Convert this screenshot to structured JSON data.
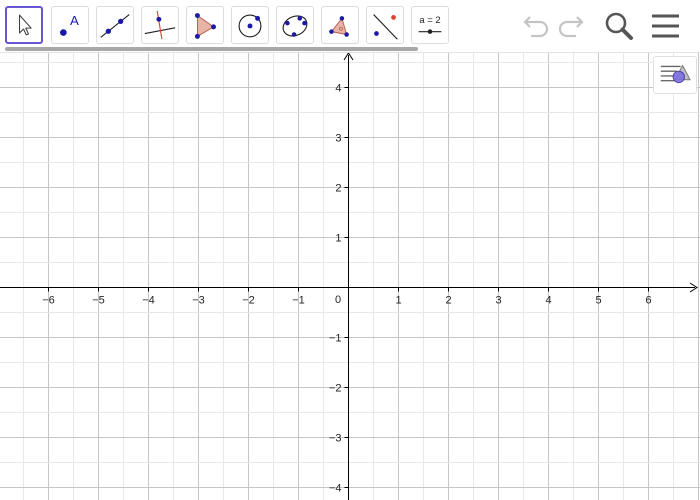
{
  "toolbar": {
    "tools": [
      {
        "name": "move-tool",
        "icon": "arrow-pointer-icon",
        "selected": true
      },
      {
        "name": "point-tool",
        "icon": "point-icon",
        "selected": false
      },
      {
        "name": "line-tool",
        "icon": "line-through-two-points-icon",
        "selected": false
      },
      {
        "name": "perpendicular-line-tool",
        "icon": "perpendicular-line-icon",
        "selected": false
      },
      {
        "name": "polygon-tool",
        "icon": "polygon-icon",
        "selected": false
      },
      {
        "name": "circle-center-point-tool",
        "icon": "circle-center-point-icon",
        "selected": false
      },
      {
        "name": "conic-five-points-tool",
        "icon": "conic-five-points-icon",
        "selected": false
      },
      {
        "name": "angle-tool",
        "icon": "angle-icon",
        "selected": false
      },
      {
        "name": "reflect-tool",
        "icon": "reflect-about-line-icon",
        "selected": false
      },
      {
        "name": "slider-tool",
        "icon": "slider-icon",
        "selected": false
      }
    ],
    "slider_icon_label": "a = 2",
    "point_icon_label": "A",
    "controls": [
      "undo-icon",
      "redo-icon",
      "search-icon",
      "menu-icon"
    ]
  },
  "graphics": {
    "x_ticks": [
      "−6",
      "−5",
      "−4",
      "−3",
      "−2",
      "−1",
      "1",
      "2",
      "3",
      "4",
      "5",
      "6"
    ],
    "y_ticks_positive": [
      "1",
      "2",
      "3",
      "4"
    ],
    "y_ticks_negative": [
      "−1",
      "−2",
      "−3",
      "−4"
    ],
    "origin_label": "0",
    "grid": true,
    "colors": {
      "grid": "#c0c0c0",
      "axis": "#000000",
      "accent": "#6557d2",
      "point": "#1a1aa6",
      "polygon_fill": "#e8b3a8",
      "polygon_stroke": "#b85a4a",
      "perp_line": "#d9442b"
    }
  },
  "style_bar": {
    "icon": "style-bar-toggle-icon"
  }
}
